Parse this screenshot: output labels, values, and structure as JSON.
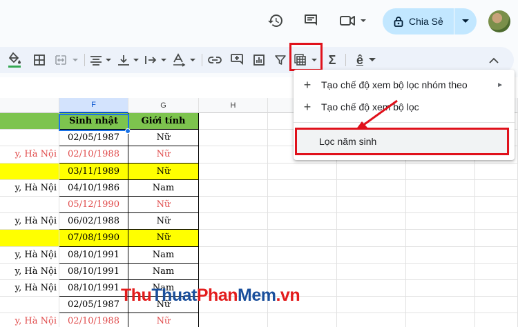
{
  "header": {
    "share_label": "Chia Sẻ",
    "icons": [
      "history-icon",
      "comment-icon",
      "meet-icon",
      "lock-icon",
      "avatar"
    ]
  },
  "toolbar": {
    "icons": [
      "fill-color-icon",
      "borders-icon",
      "merge-cells-icon",
      "align-icon",
      "vertical-align-icon",
      "text-wrap-icon",
      "text-rotation-icon",
      "link-icon",
      "comment-add-icon",
      "chart-icon",
      "filter-icon",
      "filter-views-icon",
      "functions-icon",
      "input-tools-icon",
      "collapse-icon"
    ],
    "function_symbol": "Σ",
    "input_tools_symbol": "ê"
  },
  "columns": [
    "F",
    "G",
    "H"
  ],
  "table": {
    "header": {
      "col_e": "",
      "col_f": "Sinh nhật",
      "col_g": "Giới tính"
    },
    "rows": [
      {
        "e": "",
        "f": "02/05/1987",
        "g": "Nữ",
        "style": "normal"
      },
      {
        "e": "y, Hà Nội",
        "f": "02/10/1988",
        "g": "Nữ",
        "style": "red"
      },
      {
        "e": "",
        "f": "03/11/1989",
        "g": "Nữ",
        "style": "yellow"
      },
      {
        "e": "y, Hà Nội",
        "f": "04/10/1986",
        "g": "Nam",
        "style": "normal"
      },
      {
        "e": "",
        "f": "05/12/1990",
        "g": "Nữ",
        "style": "red"
      },
      {
        "e": "y, Hà Nội",
        "f": "06/02/1988",
        "g": "Nữ",
        "style": "normal"
      },
      {
        "e": "",
        "f": "07/08/1990",
        "g": "Nữ",
        "style": "yellow"
      },
      {
        "e": "y, Hà Nội",
        "f": "08/10/1991",
        "g": "Nam",
        "style": "normal"
      },
      {
        "e": "y, Hà Nội",
        "f": "08/10/1991",
        "g": "Nam",
        "style": "normal"
      },
      {
        "e": "y, Hà Nội",
        "f": "08/10/1991",
        "g": "Nam",
        "style": "normal"
      },
      {
        "e": "",
        "f": "02/05/1987",
        "g": "Nữ",
        "style": "normal"
      },
      {
        "e": "y, Hà Nội",
        "f": "02/10/1988",
        "g": "Nữ",
        "style": "red"
      }
    ]
  },
  "menu": {
    "items": [
      {
        "label": "Tạo chế độ xem bộ lọc nhóm theo",
        "has_submenu": true
      },
      {
        "label": "Tạo chế độ xem bộ lọc",
        "has_submenu": false
      },
      {
        "label": "Lọc năm sinh",
        "has_submenu": false
      }
    ]
  },
  "watermark": {
    "part1": "Thu",
    "part2": "Thuat",
    "part3": "Phan",
    "part4": "Mem",
    "part5": ".vn"
  },
  "colors": {
    "accent": "#c2e7ff",
    "header_green": "#7dc44e",
    "highlight_yellow": "#ffff00",
    "red_text": "#e04a4a",
    "annotation_red": "#e0111b",
    "selection_blue": "#1a73e8"
  }
}
